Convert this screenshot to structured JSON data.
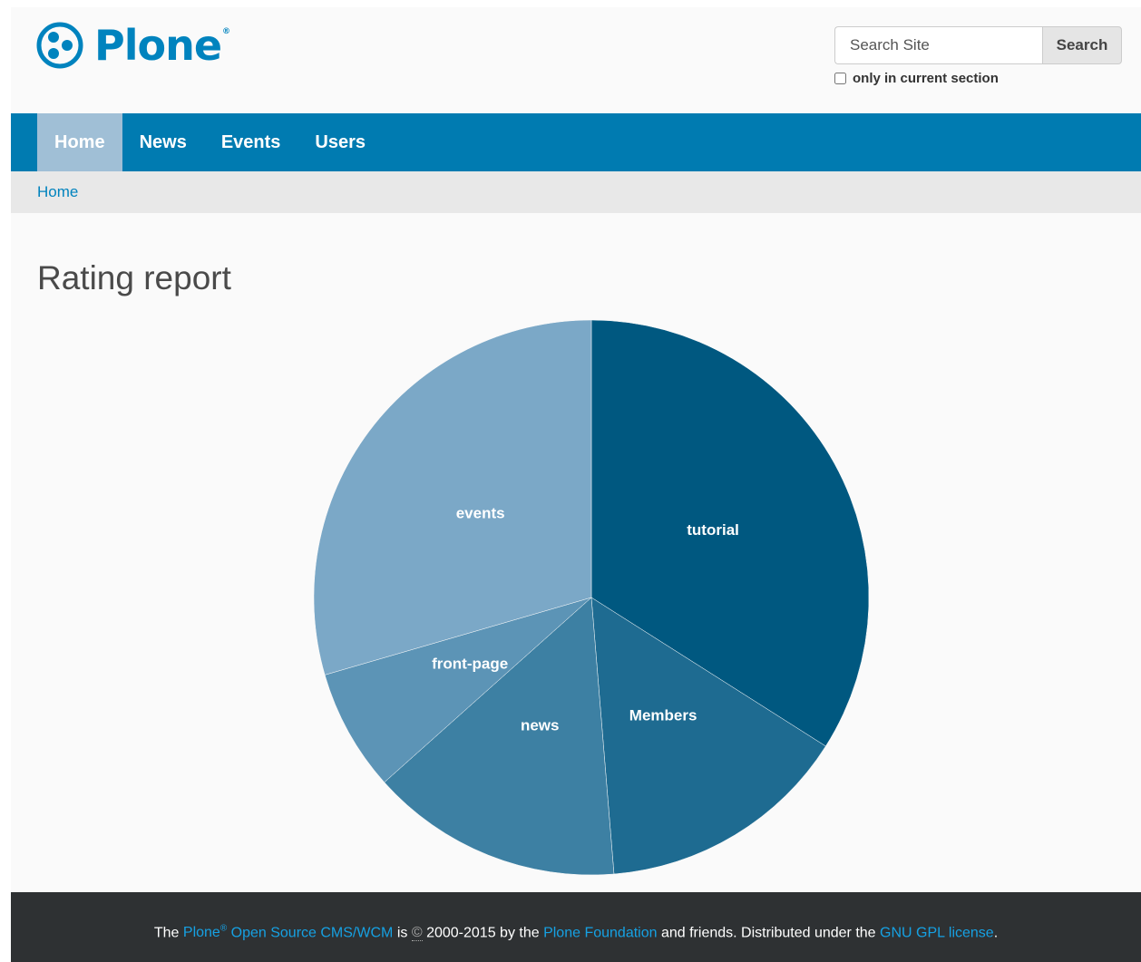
{
  "brand": {
    "name": "Plone",
    "reg_mark": "®",
    "color": "#0083be"
  },
  "search": {
    "placeholder": "Search Site",
    "button_label": "Search",
    "section_option_label": "only in current section"
  },
  "nav": {
    "items": [
      "Home",
      "News",
      "Events",
      "Users"
    ],
    "active": "Home",
    "color": "#007bb1",
    "active_color": "#a0bfd6"
  },
  "breadcrumb": {
    "home_label": "Home"
  },
  "page": {
    "title": "Rating report"
  },
  "chart_data": {
    "type": "pie",
    "slices": [
      {
        "label": "tutorial",
        "value": 34,
        "color": "#005880"
      },
      {
        "label": "Members",
        "value": 14.7,
        "color": "#1e6b91"
      },
      {
        "label": "news",
        "value": 14.7,
        "color": "#3d80a3"
      },
      {
        "label": "front-page",
        "value": 7.1,
        "color": "#5c94b6"
      },
      {
        "label": "events",
        "value": 29.5,
        "color": "#7ba8c7"
      }
    ]
  },
  "footer": {
    "text_the": "The",
    "plone_link": "Plone",
    "reg_mark": "®",
    "cms_link": "Open Source CMS/WCM",
    "text_is": "is",
    "copyright_symbol": "©",
    "years_text": "2000-2015 by the",
    "foundation_link": "Plone Foundation",
    "text_distributed": "and friends. Distributed under the",
    "license_link": "GNU GPL license",
    "text_end": "."
  }
}
